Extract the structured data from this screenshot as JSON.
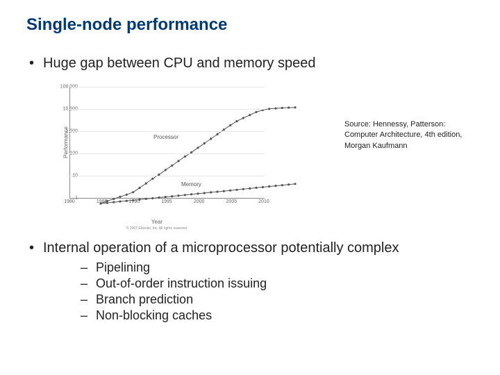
{
  "title": "Single-node performance",
  "bullets": {
    "b1": "Huge gap between CPU and memory speed",
    "b2": "Internal operation of a microprocessor potentially complex",
    "sub": [
      "Pipelining",
      "Out-of-order instruction issuing",
      "Branch prediction",
      "Non-blocking caches"
    ]
  },
  "source_caption": "Source: Hennessy, Patterson: Computer Architecture, 4th edition, Morgan Kaufmann",
  "chart_copyright": "© 2007 Elsevier, Inc. All rights reserved.",
  "chart_data": {
    "type": "line",
    "title": "",
    "xlabel": "Year",
    "ylabel": "Performance",
    "x": [
      1980,
      1985,
      1990,
      1995,
      2000,
      2005,
      2010
    ],
    "yticks": [
      1,
      10,
      100,
      1000,
      10000,
      100000
    ],
    "ytick_labels": [
      "1",
      "10",
      "100",
      "1.000",
      "10.000",
      "100.000"
    ],
    "ylim": [
      1,
      100000
    ],
    "yscale": "log",
    "series": [
      {
        "name": "Processor",
        "x": [
          1980,
          1981,
          1982,
          1983,
          1984,
          1985,
          1986,
          1987,
          1988,
          1989,
          1990,
          1991,
          1992,
          1993,
          1994,
          1995,
          1996,
          1997,
          1998,
          1999,
          2000,
          2001,
          2002,
          2003,
          2004,
          2005,
          2006,
          2007,
          2008,
          2009,
          2010
        ],
        "values": [
          1,
          1.3,
          1.6,
          2.0,
          2.5,
          3.2,
          5,
          8,
          13,
          20,
          32,
          51,
          81,
          130,
          200,
          320,
          510,
          810,
          1300,
          2100,
          3300,
          5000,
          7000,
          9500,
          13000,
          16000,
          18000,
          19000,
          20000,
          20500,
          21000
        ]
      },
      {
        "name": "Memory",
        "x": [
          1980,
          1981,
          1982,
          1983,
          1984,
          1985,
          1986,
          1987,
          1988,
          1989,
          1990,
          1991,
          1992,
          1993,
          1994,
          1995,
          1996,
          1997,
          1998,
          1999,
          2000,
          2001,
          2002,
          2003,
          2004,
          2005,
          2006,
          2007,
          2008,
          2009,
          2010
        ],
        "values": [
          1,
          1.07,
          1.15,
          1.23,
          1.31,
          1.4,
          1.5,
          1.61,
          1.72,
          1.84,
          1.97,
          2.1,
          2.25,
          2.41,
          2.58,
          2.76,
          2.95,
          3.16,
          3.38,
          3.61,
          3.87,
          4.14,
          4.43,
          4.74,
          5.07,
          5.43,
          5.81,
          6.21,
          6.65,
          7.11,
          7.61
        ]
      }
    ]
  }
}
